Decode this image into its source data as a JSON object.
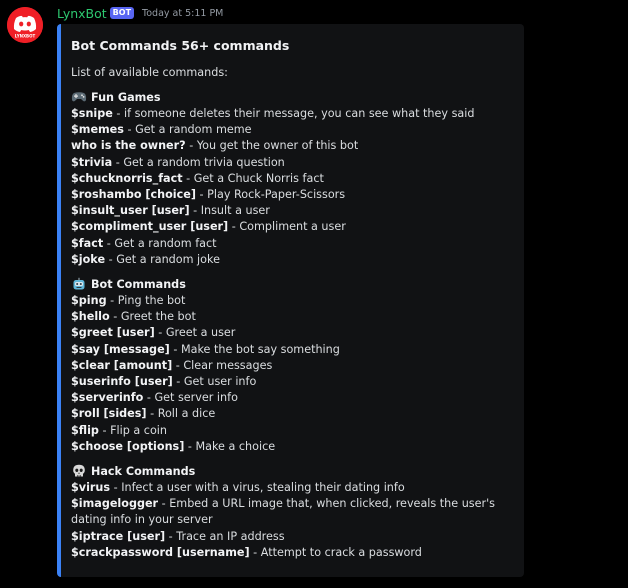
{
  "bot": {
    "username": "LynxBot",
    "tag": "BOT",
    "timestamp": "Today at 5:11 PM",
    "avatar_text": "LYNXBOT"
  },
  "embed": {
    "title": "Bot Commands 56+ commands",
    "description": "List of available commands:",
    "accent_color": "#3b82f6",
    "sections": [
      {
        "emoji": "game-controller-icon",
        "title": "Fun Games",
        "commands": [
          {
            "name": "$snipe",
            "desc": "if someone deletes their message, you can see what they said"
          },
          {
            "name": "$memes",
            "desc": "Get a random meme"
          },
          {
            "name": "who is the owner?",
            "desc": "You get the owner of this bot"
          },
          {
            "name": "$trivia",
            "desc": "Get a random trivia question"
          },
          {
            "name": "$chucknorris_fact",
            "desc": "Get a Chuck Norris fact"
          },
          {
            "name": "$roshambo [choice]",
            "desc": "Play Rock-Paper-Scissors"
          },
          {
            "name": "$insult_user [user]",
            "desc": "Insult a user"
          },
          {
            "name": "$compliment_user [user]",
            "desc": "Compliment a user"
          },
          {
            "name": "$fact",
            "desc": "Get a random fact"
          },
          {
            "name": "$joke",
            "desc": "Get a random joke"
          }
        ]
      },
      {
        "emoji": "robot-face-icon",
        "title": "Bot Commands",
        "commands": [
          {
            "name": "$ping",
            "desc": "Ping the bot"
          },
          {
            "name": "$hello",
            "desc": "Greet the bot"
          },
          {
            "name": "$greet [user]",
            "desc": "Greet a user"
          },
          {
            "name": "$say [message]",
            "desc": "Make the bot say something"
          },
          {
            "name": "$clear [amount]",
            "desc": "Clear messages"
          },
          {
            "name": "$userinfo [user]",
            "desc": "Get user info"
          },
          {
            "name": "$serverinfo",
            "desc": "Get server info"
          },
          {
            "name": "$roll [sides]",
            "desc": "Roll a dice"
          },
          {
            "name": "$flip",
            "desc": "Flip a coin"
          },
          {
            "name": "$choose [options]",
            "desc": "Make a choice"
          }
        ]
      },
      {
        "emoji": "skull-icon",
        "title": "Hack Commands",
        "commands": [
          {
            "name": "$virus",
            "desc": "Infect a user with a virus, stealing their dating info"
          },
          {
            "name": "$imagelogger",
            "desc": "Embed a URL image that, when clicked, reveals the user's dating info in your server"
          },
          {
            "name": "$iptrace [user]",
            "desc": "Trace an IP address"
          },
          {
            "name": "$crackpassword [username]",
            "desc": "Attempt to crack a password"
          }
        ]
      }
    ]
  }
}
